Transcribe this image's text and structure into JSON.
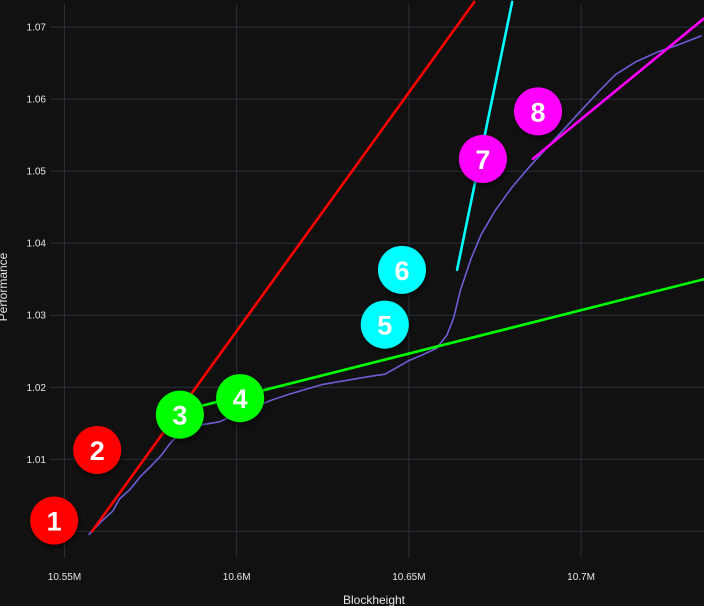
{
  "chart_data": {
    "type": "line",
    "xlabel": "Blockheight",
    "ylabel": "Performance",
    "xlim": [
      10536500,
      10735700
    ],
    "ylim": [
      0.9963,
      1.0732
    ],
    "x_ticks": [
      {
        "value": 10550000,
        "label": "10.55M"
      },
      {
        "value": 10600000,
        "label": "10.6M"
      },
      {
        "value": 10650000,
        "label": "10.65M"
      },
      {
        "value": 10700000,
        "label": "10.7M"
      }
    ],
    "y_ticks": [
      {
        "value": 1.0,
        "label": "1"
      },
      {
        "value": 1.01,
        "label": "1.01"
      },
      {
        "value": 1.02,
        "label": "1.02"
      },
      {
        "value": 1.03,
        "label": "1.03"
      },
      {
        "value": 1.04,
        "label": "1.04"
      },
      {
        "value": 1.05,
        "label": "1.05"
      },
      {
        "value": 1.06,
        "label": "1.06"
      },
      {
        "value": 1.07,
        "label": "1.07"
      }
    ],
    "grid": true,
    "colors": {
      "background": "#111111",
      "grid": "#2a2f3a",
      "performance": "#6a5fd6",
      "red": "#ff0000",
      "green": "#00ff00",
      "cyan": "#00ffff",
      "magenta": "#ff00ff"
    },
    "performance_series": {
      "x": [
        10557000,
        10559000,
        10561000,
        10564000,
        10566000,
        10569000,
        10572000,
        10575000,
        10578000,
        10581000,
        10585000,
        10590000,
        10595000,
        10600000,
        10605000,
        10610000,
        10615000,
        10620000,
        10625000,
        10630000,
        10635000,
        10640000,
        10643000,
        10646000,
        10650000,
        10654000,
        10658000,
        10661000,
        10663000,
        10665000,
        10668000,
        10671000,
        10675000,
        10680000,
        10685000,
        10690000,
        10695000,
        10700000,
        10705000,
        10710000,
        10716000,
        10722000,
        10728000,
        10735000
      ],
      "y": [
        0.9995,
        1.0005,
        1.0015,
        1.0028,
        1.0045,
        1.0058,
        1.0076,
        1.009,
        1.0105,
        1.0124,
        1.0142,
        1.0148,
        1.0152,
        1.0163,
        1.0172,
        1.0182,
        1.019,
        1.0197,
        1.0204,
        1.0208,
        1.0212,
        1.0216,
        1.0218,
        1.0226,
        1.0237,
        1.0245,
        1.0254,
        1.0272,
        1.0296,
        1.0335,
        1.0378,
        1.0412,
        1.0445,
        1.0478,
        1.0506,
        1.0532,
        1.0558,
        1.0584,
        1.061,
        1.0634,
        1.0652,
        1.0665,
        1.0675,
        1.0688
      ]
    },
    "trend_lines": [
      {
        "color": "red",
        "x": [
          10558000,
          10669000
        ],
        "y": [
          1.0,
          1.0735
        ]
      },
      {
        "color": "green",
        "x": [
          10583000,
          10735700
        ],
        "y": [
          1.0166,
          1.035
        ]
      },
      {
        "color": "cyan",
        "x": [
          10664000,
          10680000
        ],
        "y": [
          1.0363,
          1.0735
        ]
      },
      {
        "color": "magenta",
        "x": [
          10686000,
          10735700
        ],
        "y": [
          1.0517,
          1.0712
        ]
      }
    ],
    "markers": [
      {
        "label": "1",
        "color": "red",
        "x": 10547000,
        "y": 1.0015
      },
      {
        "label": "2",
        "color": "red",
        "x": 10559500,
        "y": 1.0113
      },
      {
        "label": "3",
        "color": "green",
        "x": 10583500,
        "y": 1.0162
      },
      {
        "label": "4",
        "color": "green",
        "x": 10601000,
        "y": 1.0185
      },
      {
        "label": "5",
        "color": "cyan",
        "x": 10643000,
        "y": 1.0287
      },
      {
        "label": "6",
        "color": "cyan",
        "x": 10648000,
        "y": 1.0363
      },
      {
        "label": "7",
        "color": "magenta",
        "x": 10671500,
        "y": 1.0517
      },
      {
        "label": "8",
        "color": "magenta",
        "x": 10687500,
        "y": 1.0583
      }
    ]
  }
}
